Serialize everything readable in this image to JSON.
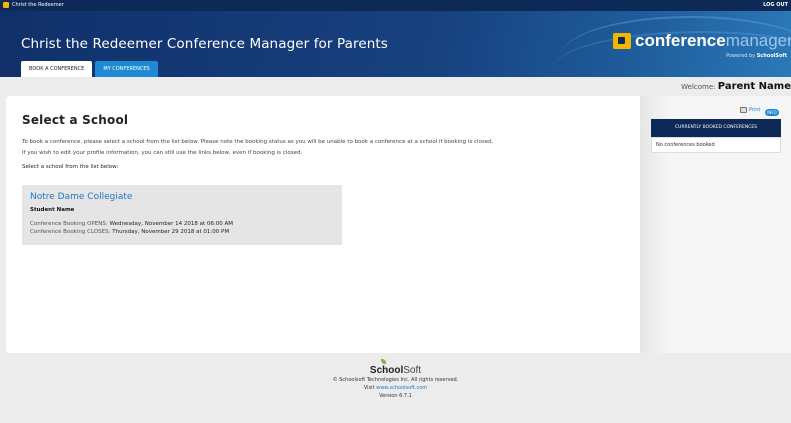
{
  "topbar": {
    "title": "Christ the Redeemer",
    "logout": "LOG OUT"
  },
  "header": {
    "heading": "Christ the Redeemer Conference Manager for Parents",
    "brand_bold": "conference",
    "brand_light": "manager",
    "powered_prefix": "Powered by",
    "powered_brand": "SchoolSoft"
  },
  "tabs": [
    {
      "label": "BOOK A CONFERENCE",
      "active": true
    },
    {
      "label": "MY CONFERENCES",
      "active": false
    }
  ],
  "welcome": {
    "label": "Welcome:",
    "name": "Parent Name"
  },
  "main": {
    "title": "Select a School",
    "para1": "To book a conference, please select a school from the list below. Please note the booking status as you will be unable to book a conference at a school if booking is closed.",
    "para2": "If you wish to edit your profile information, you can still use the links below, even if booking is closed.",
    "select_label": "Select a school from the list below:"
  },
  "school": {
    "name": "Notre Dame Collegiate",
    "student": "Student Name",
    "opens_label": "Conference Booking OPENS:",
    "opens_value": "Wednesday, November 14 2018 at 06:00 AM",
    "closes_label": "Conference Booking CLOSES:",
    "closes_value": "Thursday, November 29 2018 at 01:00 PM"
  },
  "sidebar": {
    "print": "Print",
    "info_badge": "INFO",
    "booked_heading": "CURRENTLY BOOKED CONFERENCES",
    "booked_empty": "No conferences booked"
  },
  "footer": {
    "logo_bold": "School",
    "logo_light": "Soft",
    "copyright": "© Schoolsoft Technologies Inc. All rights reserved.",
    "visit_prefix": "Visit",
    "visit_link": "www.schoolsoft.com",
    "version": "Version 6.7.1"
  },
  "colors": {
    "navy": "#0d2a57",
    "accent_blue": "#1e8ad6",
    "link_blue": "#1e79c9",
    "brand_yellow": "#f2b600"
  }
}
